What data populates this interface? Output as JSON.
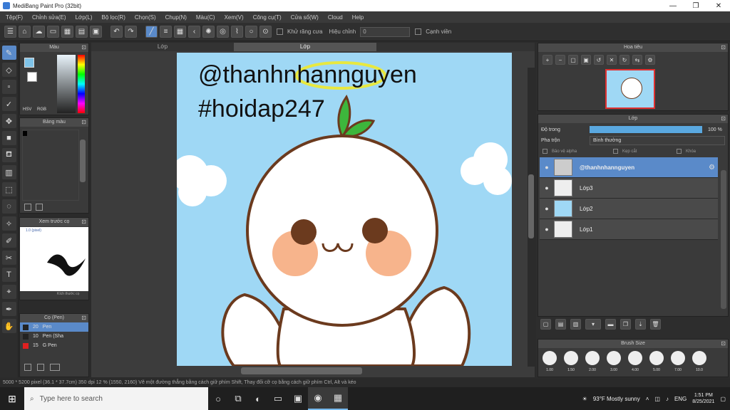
{
  "window": {
    "title": "MediBang Paint Pro (32bit)",
    "controls": [
      "—",
      "❐",
      "✕"
    ]
  },
  "menu": [
    "Tệp(F)",
    "Chỉnh sửa(E)",
    "Lớp(L)",
    "Bộ lọc(R)",
    "Chọn(S)",
    "Chụp(N)",
    "Màu(C)",
    "Xem(V)",
    "Công cụ(T)",
    "Cửa sổ(W)",
    "Cloud",
    "Help"
  ],
  "toolbar": {
    "auto_fix_label": "Khử răng cưa",
    "correction_label": "Hiệu chỉnh",
    "correction_value": "0",
    "snap_label": "Cạnh viền"
  },
  "color_panel": {
    "title": "Màu",
    "hsv": "HSV",
    "rgb": "RGB"
  },
  "palette_panel": {
    "title": "Bảng màu"
  },
  "brush_preview_panel": {
    "title": "Xem trước cọ",
    "value": "1.0 (pixel)",
    "size_text": "Kích thước cọ"
  },
  "brush_list_panel": {
    "title": "Cọ (Pen)",
    "items": [
      {
        "size": "20",
        "name": "Pen"
      },
      {
        "size": "10",
        "name": "Pen (Sha"
      },
      {
        "size": "15",
        "name": "G Pen"
      }
    ]
  },
  "canvas": {
    "tabs": [
      "Lớp",
      "Lớp"
    ],
    "text_line1": "@thanhnhannguyen",
    "text_line2": "#hoidap247"
  },
  "navigator": {
    "title": "Hoa tiêu"
  },
  "layers": {
    "title": "Lớp",
    "opacity_label": "Độ trong",
    "opacity_value": "100 %",
    "blend_label": "Pha trộn",
    "blend_value": "Bình thường",
    "options": [
      "Bảo vệ alpha",
      "Kẹp cắt",
      "Khóa"
    ],
    "items": [
      {
        "name": "@thanhnhannguyen",
        "active": true
      },
      {
        "name": "Lớp3",
        "active": false
      },
      {
        "name": "Lớp2",
        "active": false
      },
      {
        "name": "Lớp1",
        "active": false
      }
    ]
  },
  "brush_size": {
    "title": "Brush Size",
    "values": [
      "1.00",
      "1.50",
      "2.00",
      "3.00",
      "4.00",
      "5.00",
      "7.00",
      "10.0"
    ]
  },
  "status": "5000 * 5200 pixel (36.1 * 37.7cm) 350 dpi 12 % (1550, 2160) Vẽ một đường thẳng bằng cách giữ phím Shift, Thay đổi cỡ cọ bằng cách giữ phím Ctrl, Alt và kéo",
  "taskbar": {
    "search_placeholder": "Type here to search",
    "weather": "93°F Mostly sunny",
    "lang": "ENG",
    "time": "1:51 PM",
    "date": "8/25/2021"
  },
  "colors": {
    "accent": "#5a8ac9",
    "canvas_bg": "#9fd8f5",
    "mascot_outline": "#6b3a1e",
    "leaf": "#3db63c",
    "halo": "#e8e840"
  }
}
